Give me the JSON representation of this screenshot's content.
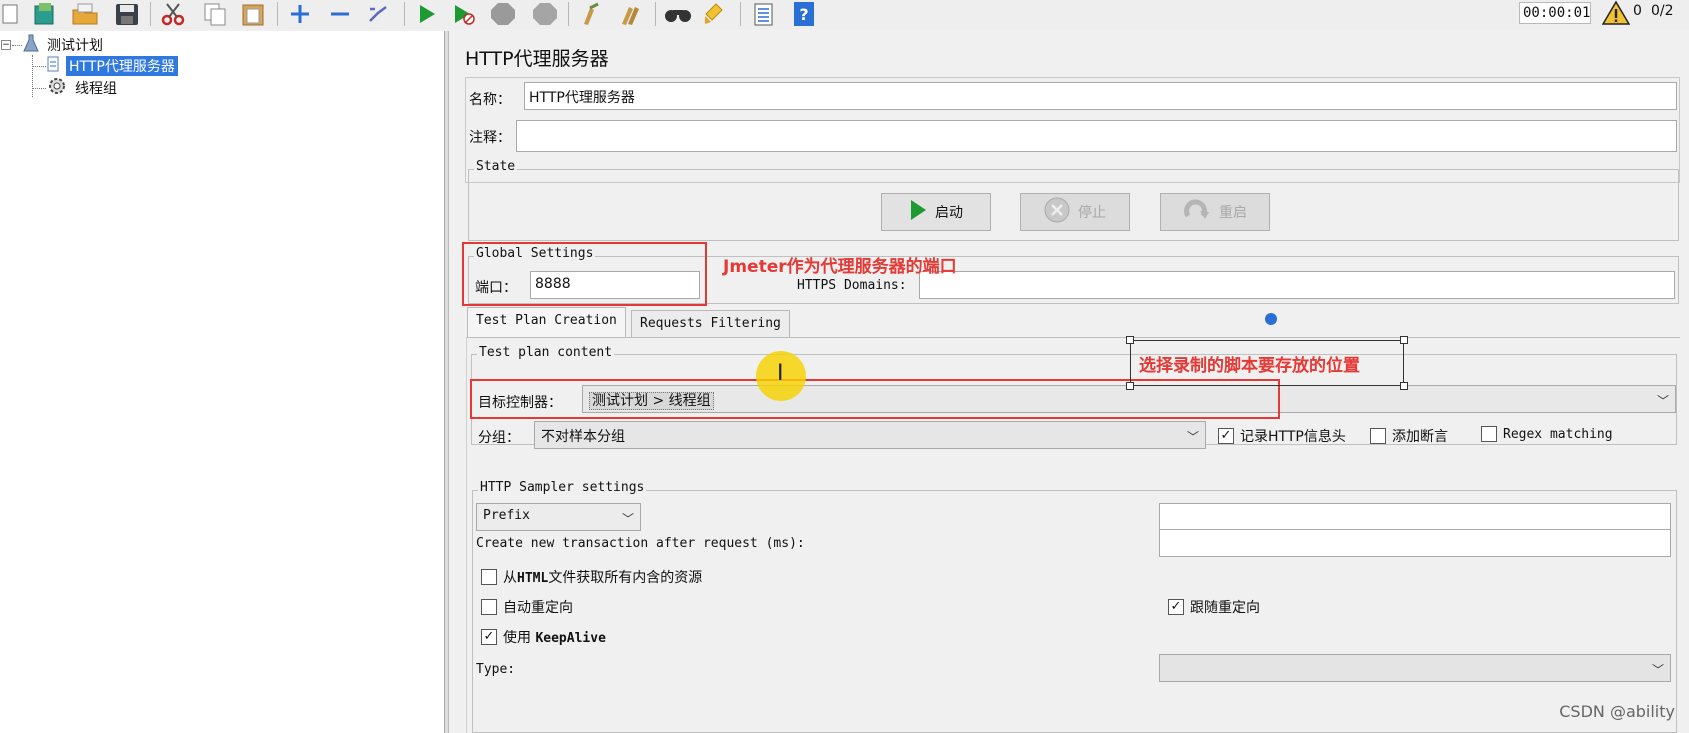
{
  "toolbar": {
    "timer": "00:00:01",
    "warning_count": "0",
    "threads": "0/2"
  },
  "tree": {
    "root": "测试计划",
    "items": [
      "HTTP代理服务器",
      "线程组"
    ]
  },
  "panel": {
    "title": "HTTP代理服务器",
    "name_label": "名称：",
    "name_value": "HTTP代理服务器",
    "comment_label": "注释：",
    "comment_value": "",
    "state": {
      "title": "State",
      "start": "启动",
      "stop": "停止",
      "restart": "重启"
    },
    "global": {
      "title": "Global Settings",
      "port_label": "端口：",
      "port_value": "8888",
      "https_label": "HTTPS Domains:",
      "https_value": ""
    },
    "tabs": [
      "Test Plan Creation",
      "Requests Filtering"
    ],
    "test_plan": {
      "title": "Test plan content",
      "target_label": "目标控制器：",
      "target_value": "测试计划 > 线程组",
      "group_label": "分组：",
      "group_value": "不对样本分组",
      "record_headers": "记录HTTP信息头",
      "record_headers_checked": true,
      "add_assertions": "添加断言",
      "add_assertions_checked": false,
      "regex": "Regex matching",
      "regex_checked": false
    },
    "sampler": {
      "title": "HTTP Sampler settings",
      "prefix": "Prefix",
      "prefix_value": "",
      "transaction_label": "Create new transaction after request (ms):",
      "transaction_value": "",
      "fetch_resources_bold": "HTML",
      "fetch_resources_pre": "从",
      "fetch_resources_post": "文件获取所有内含的资源",
      "fetch_resources_checked": false,
      "auto_redirect": "自动重定向",
      "auto_redirect_checked": false,
      "follow_redirect": "跟随重定向",
      "follow_redirect_checked": true,
      "keepalive_pre": "使用",
      "keepalive_bold": "KeepAlive",
      "keepalive_checked": true,
      "type_label": "Type:",
      "type_value": ""
    }
  },
  "annotations": {
    "port_note": "Jmeter作为代理服务器的端口",
    "target_note": "选择录制的脚本要存放的位置"
  },
  "watermark": "CSDN @ability",
  "colors": {
    "annotation_red": "#e53935",
    "selection_blue": "#2f78e0",
    "start_green": "#1e9a33"
  }
}
